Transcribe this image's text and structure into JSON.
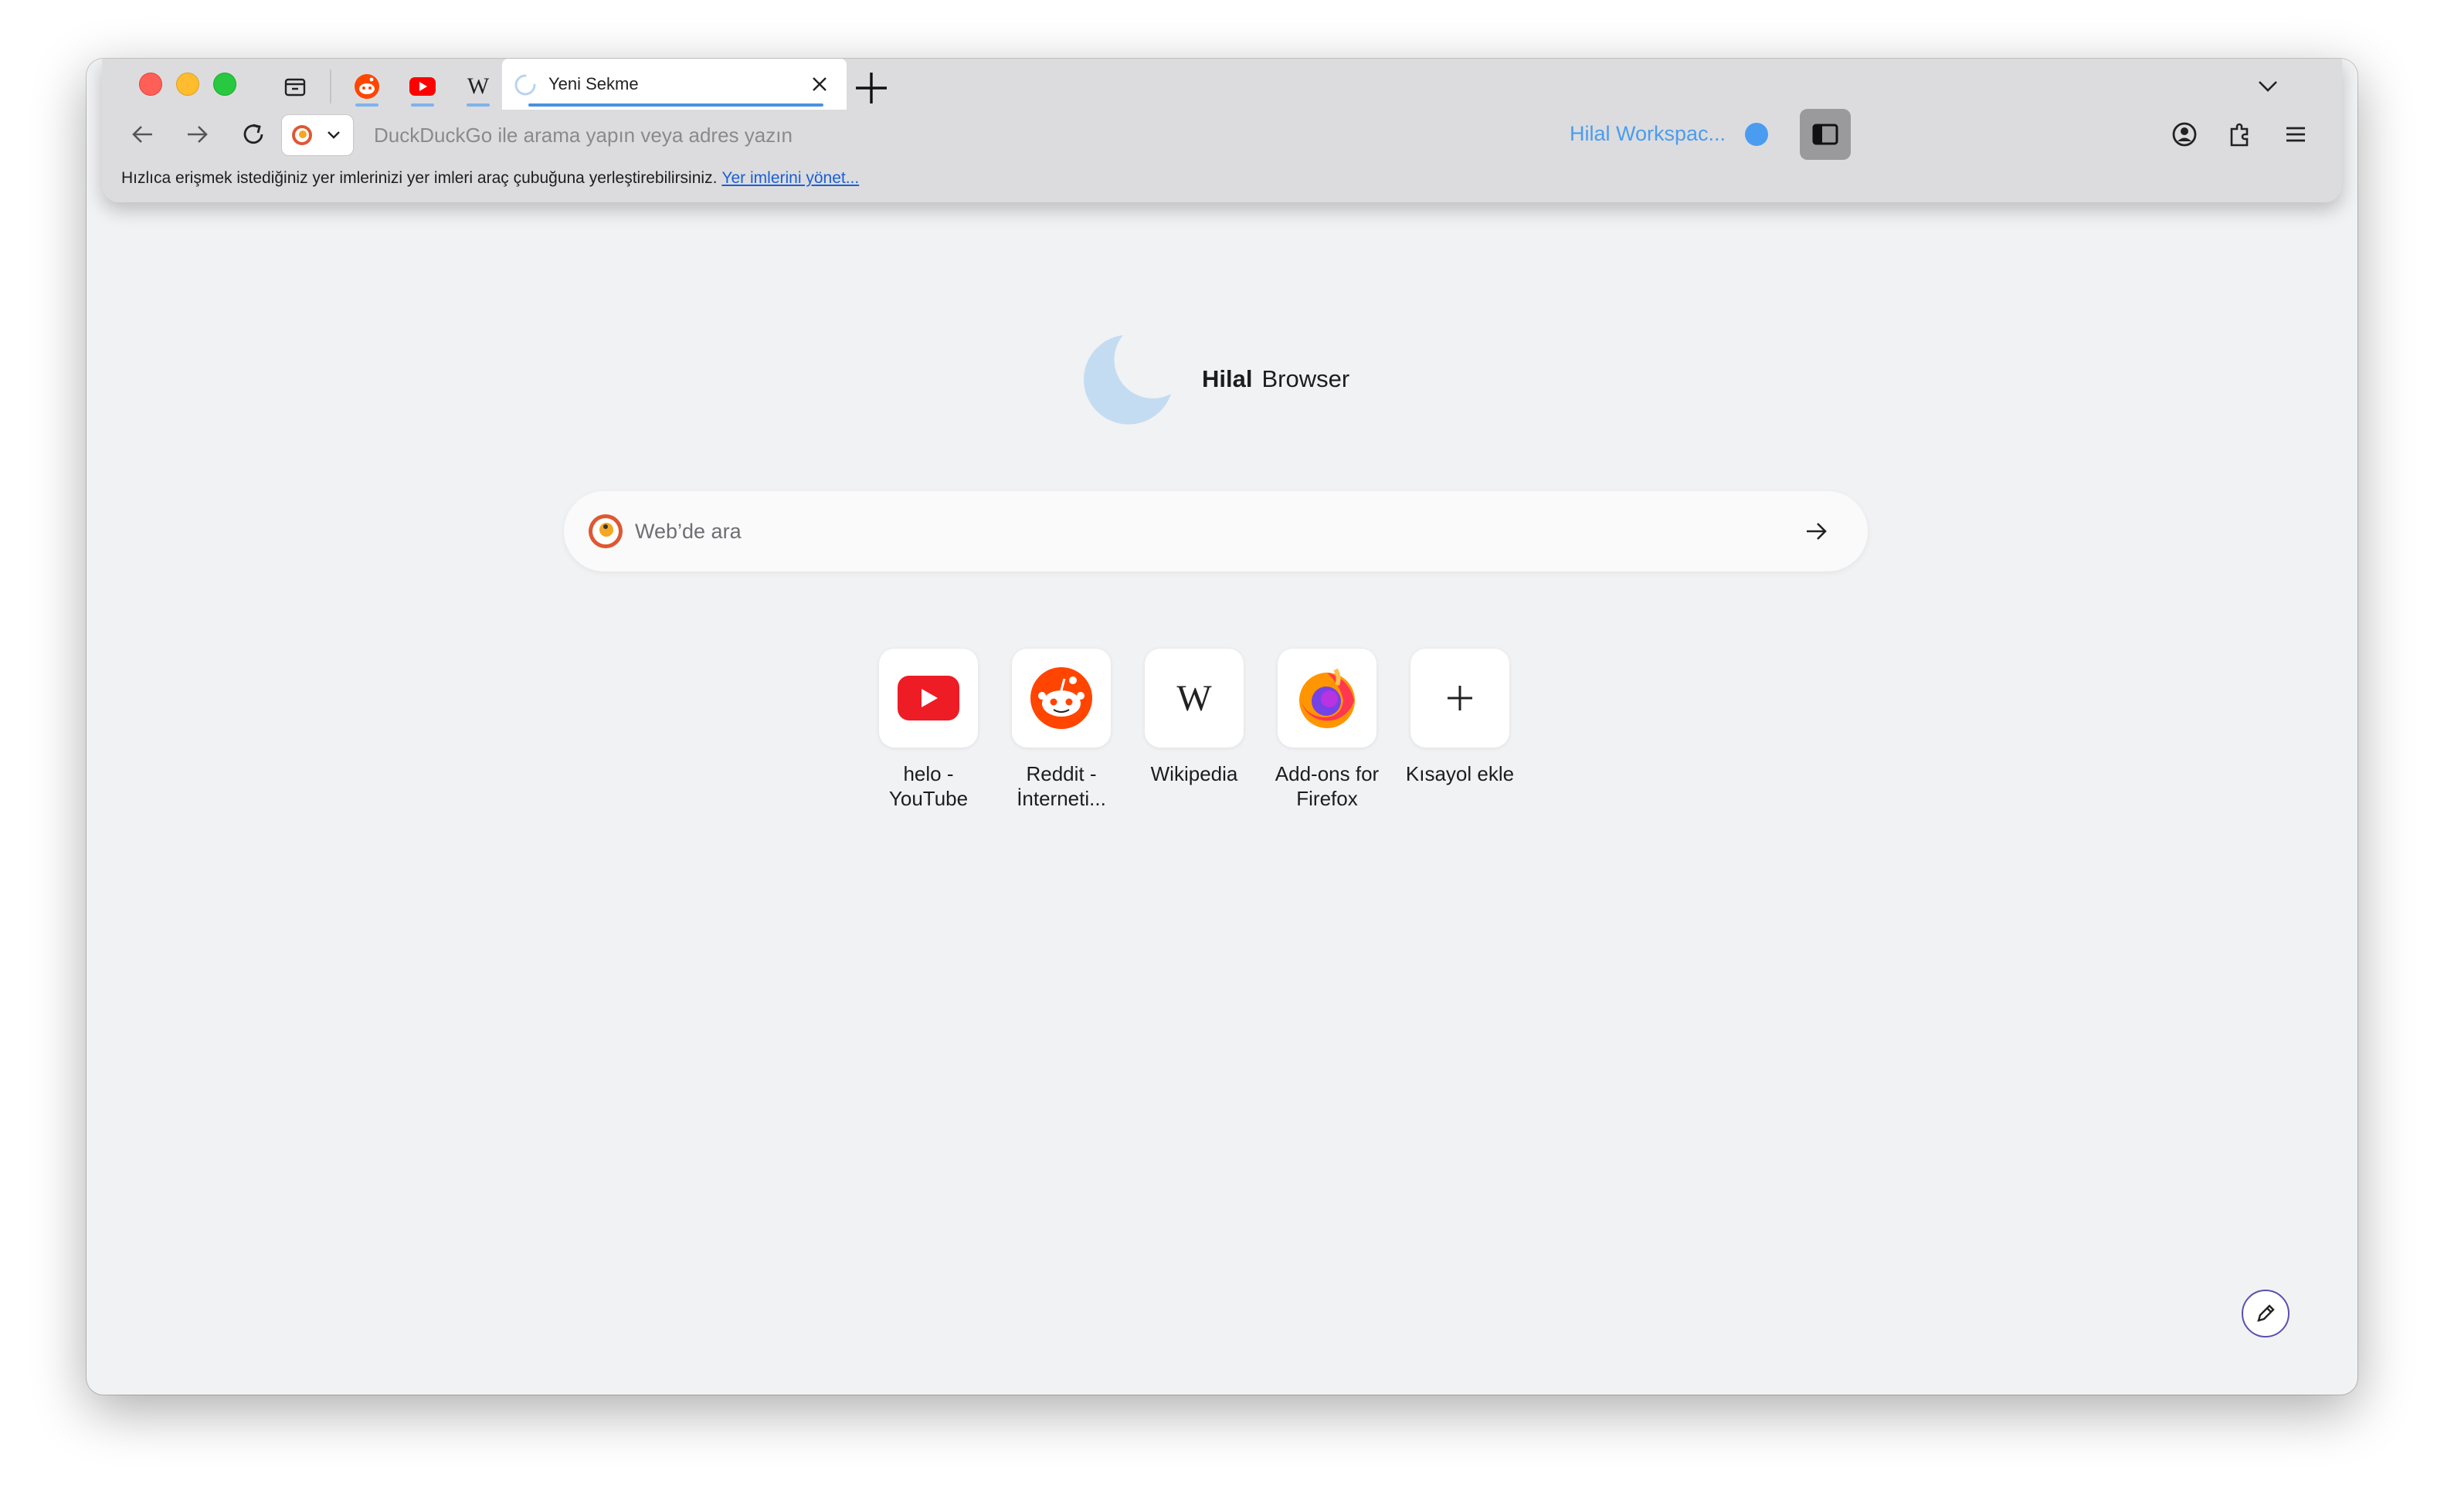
{
  "tabs": {
    "pinned": [
      {
        "name": "Reddit"
      },
      {
        "name": "YouTube"
      },
      {
        "name": "Wikipedia"
      }
    ],
    "active_title": "Yeni Sekme"
  },
  "toolbar": {
    "address_placeholder": "DuckDuckGo ile arama yapın veya adres yazın",
    "workspace_label": "Hilal Workspac...",
    "workspace_color": "#4a9cf0"
  },
  "bookmarks_bar": {
    "hint": "Hızlıca erişmek istediğiniz yer imlerinizi yer imleri araç çubuğuna yerleştirebilirsiniz.",
    "manage_link": "Yer imlerini yönet..."
  },
  "newtab": {
    "brand_bold": "Hilal",
    "brand_rest": "Browser",
    "search_placeholder": "Web’de ara",
    "shortcuts": [
      {
        "label": "helo -\nYouTube",
        "icon": "youtube-icon"
      },
      {
        "label": "Reddit -\nİnterneti...",
        "icon": "reddit-icon"
      },
      {
        "label": "Wikipedia",
        "icon": "wikipedia-icon"
      },
      {
        "label": "Add-ons for\nFirefox",
        "icon": "firefox-icon"
      },
      {
        "label": "Kısayol ekle",
        "icon": "plus-icon"
      }
    ]
  },
  "colors": {
    "accent": "#4a90e2",
    "youtube": "#ff0000",
    "reddit": "#ff4500"
  }
}
